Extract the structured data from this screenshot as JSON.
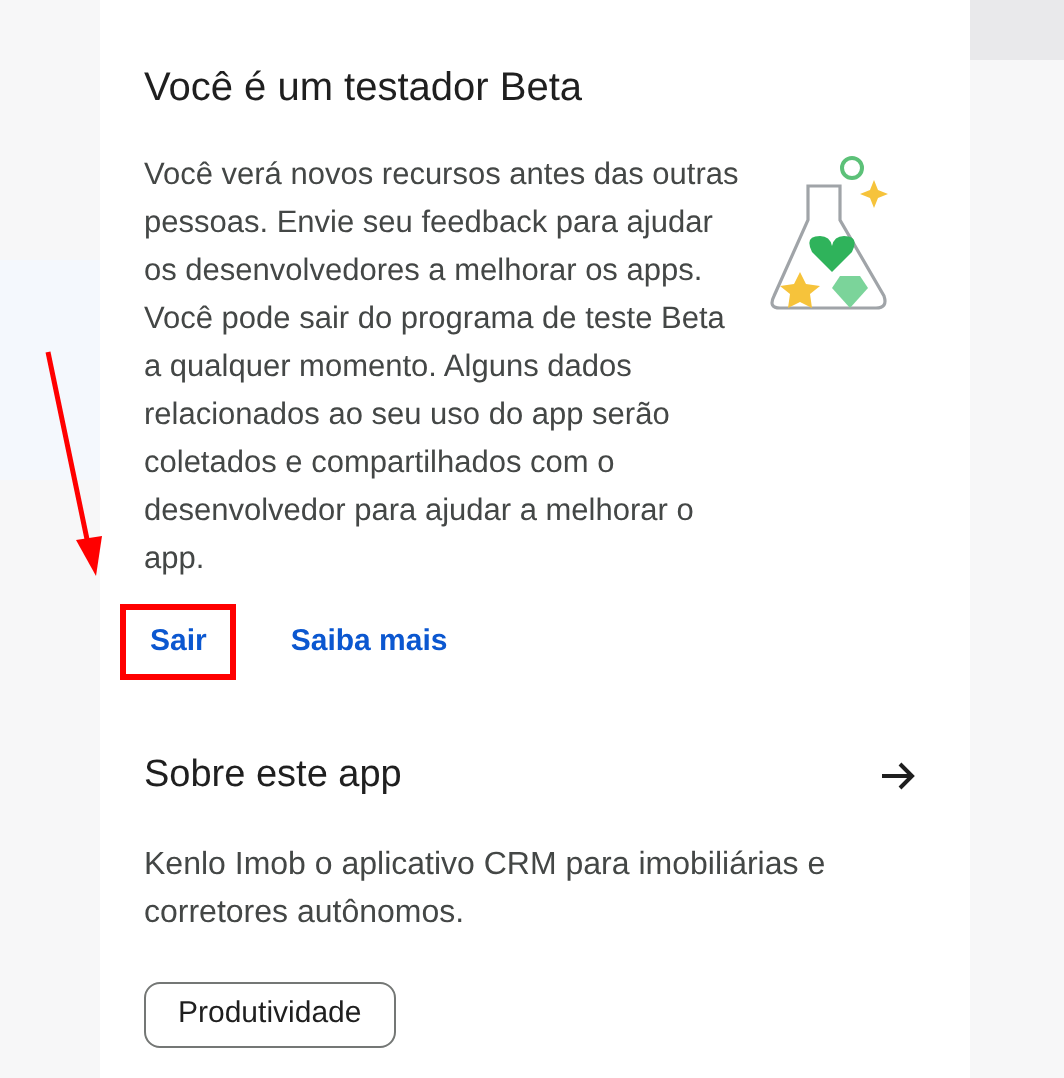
{
  "beta": {
    "title": "Você é um testador Beta",
    "text": "Você verá novos recursos antes das outras pessoas. Envie seu feedback para ajudar os desenvolvedores a melhorar os apps. Você pode sair do programa de teste Beta a qualquer momento. Alguns dados relacionados ao seu uso do app serão coletados e compartilhados com o desenvolvedor para ajudar a melhorar o app.",
    "actions": [
      {
        "label": "Sair",
        "highlighted": true
      },
      {
        "label": "Saiba mais",
        "highlighted": false
      }
    ]
  },
  "about": {
    "title": "Sobre este app",
    "text": "Kenlo Imob o aplicativo CRM para imobiliárias e corretores autônomos.",
    "tags": [
      "Produtividade"
    ]
  }
}
